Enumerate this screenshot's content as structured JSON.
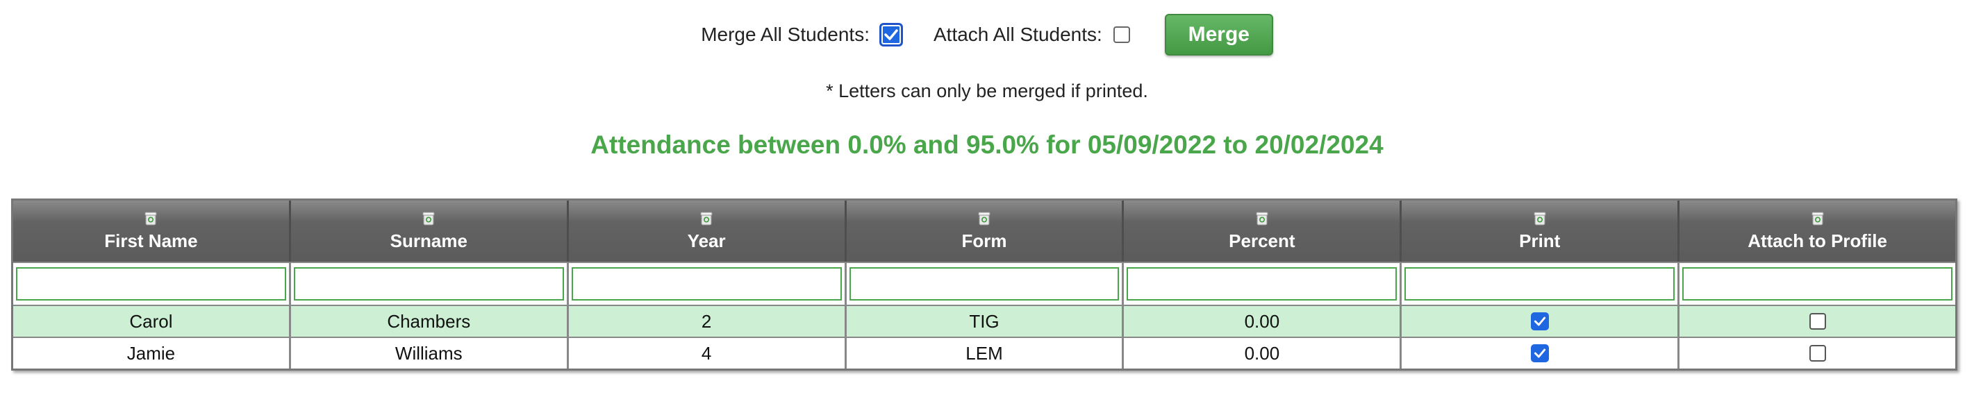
{
  "controls": {
    "merge_all_label": "Merge All Students:",
    "merge_all_checked": true,
    "attach_all_label": "Attach All Students:",
    "attach_all_checked": false,
    "merge_button_label": "Merge"
  },
  "note": "* Letters can only be merged if printed.",
  "heading": "Attendance between 0.0% and 95.0% for 05/09/2022 to 20/02/2024",
  "colors": {
    "heading_green": "#4aa64a",
    "row_highlight": "#cdf0d4",
    "checkbox_blue": "#1f67e0"
  },
  "table": {
    "columns": [
      "First Name",
      "Surname",
      "Year",
      "Form",
      "Percent",
      "Print",
      "Attach to Profile"
    ],
    "column_icon": "recycle-bin-icon",
    "rows": [
      {
        "first_name": "Carol",
        "surname": "Chambers",
        "year": "2",
        "form": "TIG",
        "percent": "0.00",
        "print": true,
        "attach": false
      },
      {
        "first_name": "Jamie",
        "surname": "Williams",
        "year": "4",
        "form": "LEM",
        "percent": "0.00",
        "print": true,
        "attach": false
      }
    ]
  }
}
